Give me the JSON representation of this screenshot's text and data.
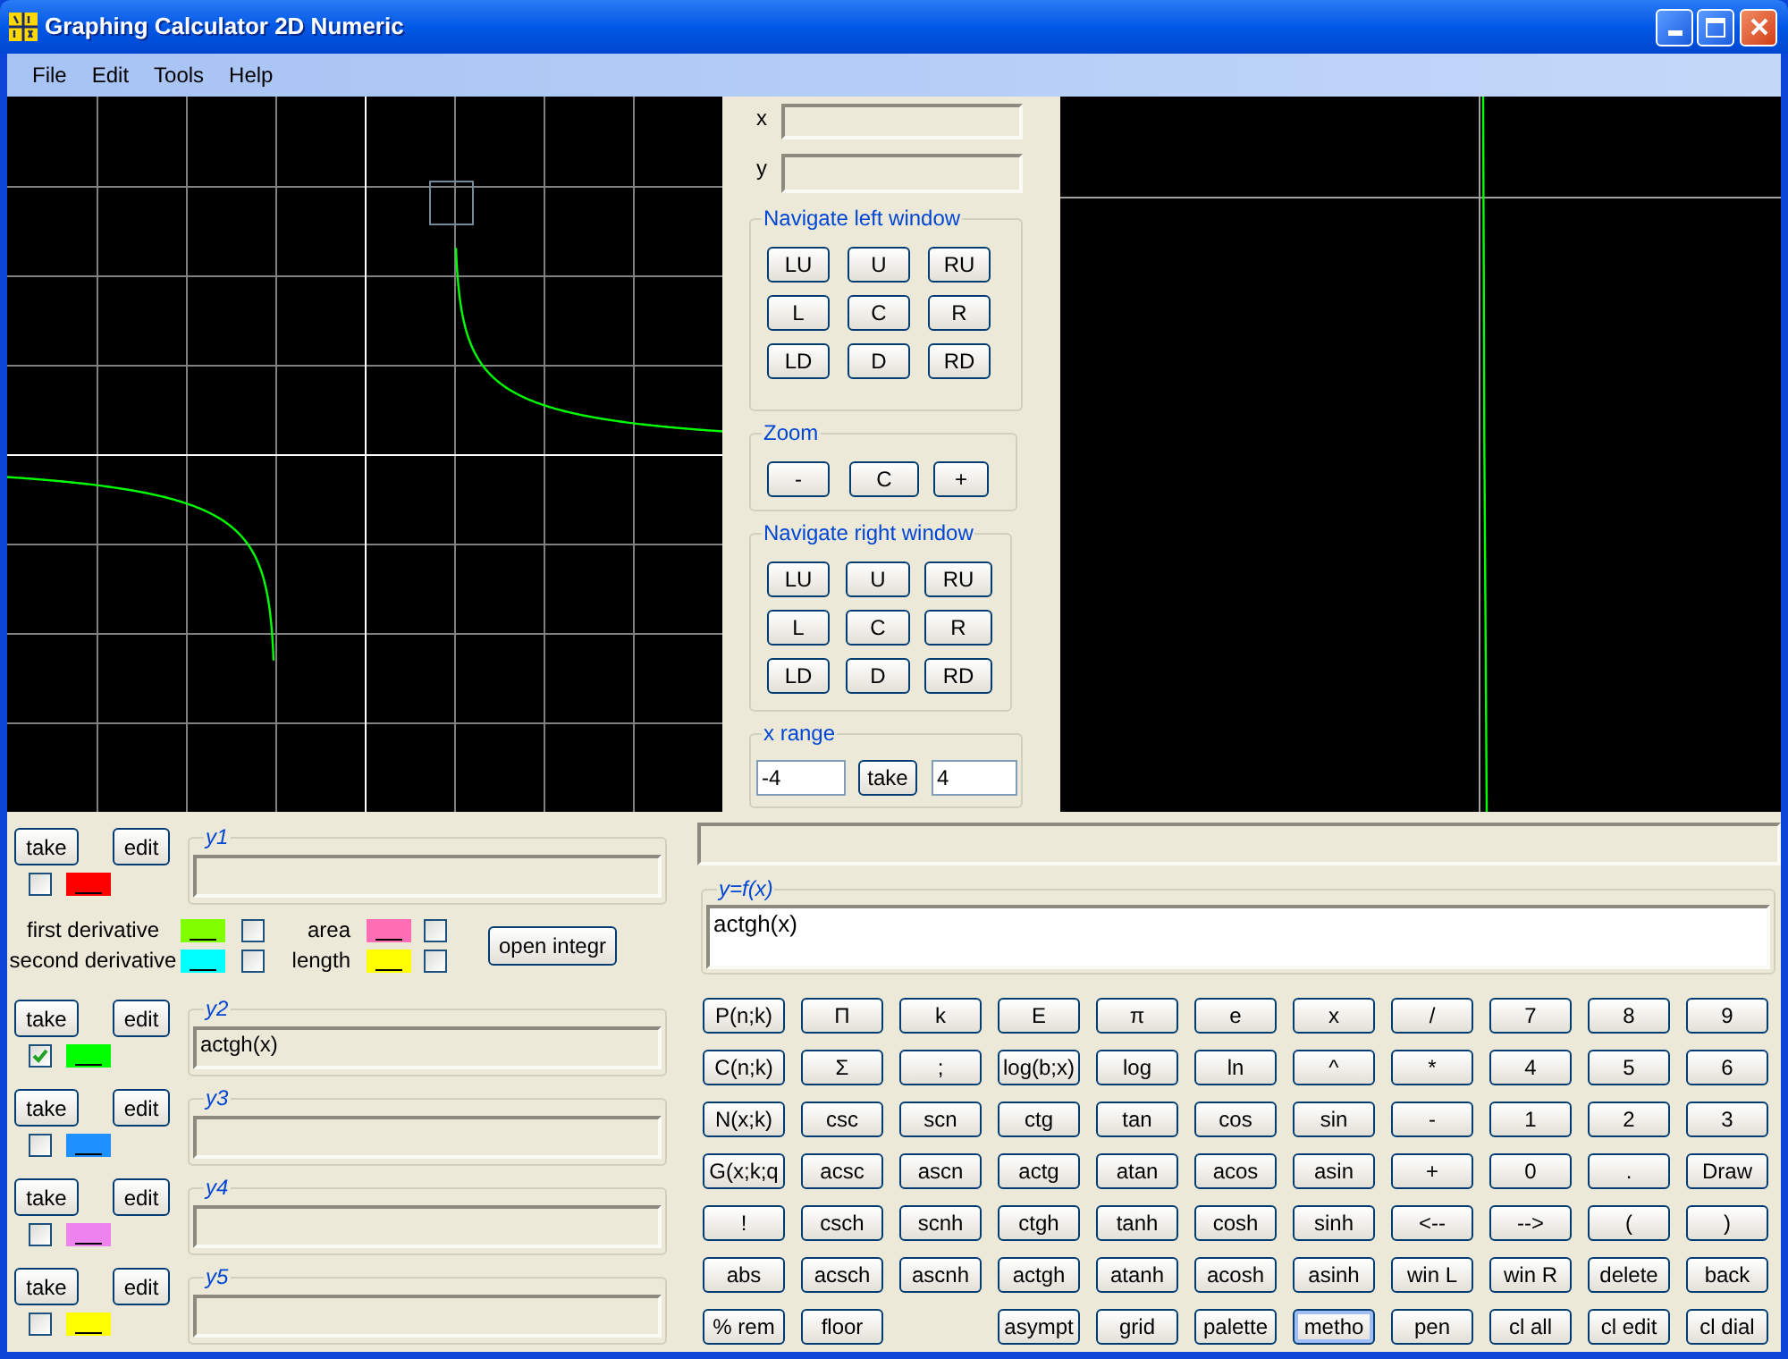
{
  "window": {
    "title": "Graphing Calculator 2D Numeric"
  },
  "menu": [
    "File",
    "Edit",
    "Tools",
    "Help"
  ],
  "coordinates": [
    {
      "label": "x"
    },
    {
      "label": "y"
    }
  ],
  "navigate_left": {
    "title": "Navigate left window",
    "buttons": [
      [
        "LU",
        "U",
        "RU"
      ],
      [
        "L",
        "C",
        "R"
      ],
      [
        "LD",
        "D",
        "RD"
      ]
    ]
  },
  "zoom": {
    "title": "Zoom",
    "buttons": [
      "-",
      "C",
      "+"
    ]
  },
  "navigate_right": {
    "title": "Navigate right window",
    "buttons": [
      [
        "LU",
        "U",
        "RU"
      ],
      [
        "L",
        "C",
        "R"
      ],
      [
        "LD",
        "D",
        "RD"
      ]
    ]
  },
  "x_range": {
    "title": "x range",
    "from": "-4",
    "button": "take",
    "to": "4"
  },
  "functions": [
    {
      "name": "y1",
      "take_button": "take",
      "edit_button": "edit",
      "checked": false,
      "color": "#ff0000"
    },
    {
      "name": "y2",
      "take_button": "take",
      "edit_button": "edit",
      "checked": true,
      "color": "#00ff00",
      "value": "actgh(x)"
    },
    {
      "name": "y3",
      "take_button": "take",
      "edit_button": "edit",
      "checked": false,
      "color": "#1e90ff"
    },
    {
      "name": "y4",
      "take_button": "take",
      "edit_button": "edit",
      "checked": false,
      "color": "#ee82ee"
    },
    {
      "name": "y5",
      "take_button": "take",
      "edit_button": "edit",
      "checked": false,
      "color": "#ffff00"
    }
  ],
  "analysis": {
    "derivatives": [
      {
        "label": "first derivative",
        "color": "#80ff00",
        "checked": false
      },
      {
        "label": "second derivative",
        "color": "#00ffff",
        "checked": false
      }
    ],
    "integrals": [
      {
        "label": "area",
        "color": "#ff6eb4",
        "checked": false
      },
      {
        "label": "length",
        "color": "#ffff00",
        "checked": false
      }
    ],
    "button": "open integr"
  },
  "expression": {
    "legend": "y=f(x)",
    "value": "actgh(x)"
  },
  "keypad": [
    [
      {
        "kind": "key",
        "label": "P(n;k)",
        "focused": false
      },
      {
        "kind": "key",
        "label": "Π",
        "focused": false
      },
      {
        "kind": "key",
        "label": "k",
        "focused": false
      },
      {
        "kind": "key",
        "label": "E",
        "focused": false
      },
      {
        "kind": "key",
        "label": "π",
        "focused": false
      },
      {
        "kind": "key",
        "label": "e",
        "focused": false
      },
      {
        "kind": "key",
        "label": "x",
        "focused": false
      },
      {
        "kind": "key",
        "label": "/",
        "focused": false
      },
      {
        "kind": "key",
        "label": "7",
        "focused": false
      },
      {
        "kind": "key",
        "label": "8",
        "focused": false
      },
      {
        "kind": "key",
        "label": "9",
        "focused": false
      }
    ],
    [
      {
        "kind": "key",
        "label": "C(n;k)",
        "focused": false
      },
      {
        "kind": "key",
        "label": "Σ",
        "focused": false
      },
      {
        "kind": "key",
        "label": ";",
        "focused": false
      },
      {
        "kind": "key",
        "label": "log(b;x)",
        "focused": false
      },
      {
        "kind": "key",
        "label": "log",
        "focused": false
      },
      {
        "kind": "key",
        "label": "ln",
        "focused": false
      },
      {
        "kind": "key",
        "label": "^",
        "focused": false
      },
      {
        "kind": "key",
        "label": "*",
        "focused": false
      },
      {
        "kind": "key",
        "label": "4",
        "focused": false
      },
      {
        "kind": "key",
        "label": "5",
        "focused": false
      },
      {
        "kind": "key",
        "label": "6",
        "focused": false
      }
    ],
    [
      {
        "kind": "key",
        "label": "N(x;k)",
        "focused": false
      },
      {
        "kind": "key",
        "label": "csc",
        "focused": false
      },
      {
        "kind": "key",
        "label": "scn",
        "focused": false
      },
      {
        "kind": "key",
        "label": "ctg",
        "focused": false
      },
      {
        "kind": "key",
        "label": "tan",
        "focused": false
      },
      {
        "kind": "key",
        "label": "cos",
        "focused": false
      },
      {
        "kind": "key",
        "label": "sin",
        "focused": false
      },
      {
        "kind": "key",
        "label": "-",
        "focused": false
      },
      {
        "kind": "key",
        "label": "1",
        "focused": false
      },
      {
        "kind": "key",
        "label": "2",
        "focused": false
      },
      {
        "kind": "key",
        "label": "3",
        "focused": false
      }
    ],
    [
      {
        "kind": "key",
        "label": "G(x;k;q",
        "focused": false
      },
      {
        "kind": "key",
        "label": "acsc",
        "focused": false
      },
      {
        "kind": "key",
        "label": "ascn",
        "focused": false
      },
      {
        "kind": "key",
        "label": "actg",
        "focused": false
      },
      {
        "kind": "key",
        "label": "atan",
        "focused": false
      },
      {
        "kind": "key",
        "label": "acos",
        "focused": false
      },
      {
        "kind": "key",
        "label": "asin",
        "focused": false
      },
      {
        "kind": "key",
        "label": "+",
        "focused": false
      },
      {
        "kind": "key",
        "label": "0",
        "focused": false
      },
      {
        "kind": "key",
        "label": ".",
        "focused": false
      },
      {
        "kind": "key",
        "label": "Draw",
        "focused": false
      }
    ],
    [
      {
        "kind": "key",
        "label": "!",
        "focused": false
      },
      {
        "kind": "key",
        "label": "csch",
        "focused": false
      },
      {
        "kind": "key",
        "label": "scnh",
        "focused": false
      },
      {
        "kind": "key",
        "label": "ctgh",
        "focused": false
      },
      {
        "kind": "key",
        "label": "tanh",
        "focused": false
      },
      {
        "kind": "key",
        "label": "cosh",
        "focused": false
      },
      {
        "kind": "key",
        "label": "sinh",
        "focused": false
      },
      {
        "kind": "key",
        "label": "<--",
        "focused": false
      },
      {
        "kind": "key",
        "label": "-->",
        "focused": false
      },
      {
        "kind": "key",
        "label": "(",
        "focused": false
      },
      {
        "kind": "key",
        "label": ")",
        "focused": false
      }
    ],
    [
      {
        "kind": "key",
        "label": "abs",
        "focused": false
      },
      {
        "kind": "key",
        "label": "acsch",
        "focused": false
      },
      {
        "kind": "key",
        "label": "ascnh",
        "focused": false
      },
      {
        "kind": "key",
        "label": "actgh",
        "focused": false
      },
      {
        "kind": "key",
        "label": "atanh",
        "focused": false
      },
      {
        "kind": "key",
        "label": "acosh",
        "focused": false
      },
      {
        "kind": "key",
        "label": "asinh",
        "focused": false
      },
      {
        "kind": "key",
        "label": "win L",
        "focused": false
      },
      {
        "kind": "key",
        "label": "win R",
        "focused": false
      },
      {
        "kind": "key",
        "label": "delete",
        "focused": false
      },
      {
        "kind": "key",
        "label": "back",
        "focused": false
      }
    ],
    [
      {
        "kind": "key",
        "label": "% rem",
        "focused": false
      },
      {
        "kind": "key",
        "label": "floor",
        "focused": false
      },
      {
        "kind": "blank"
      },
      {
        "kind": "key",
        "label": "asympt",
        "focused": false
      },
      {
        "kind": "key",
        "label": "grid",
        "focused": false
      },
      {
        "kind": "key",
        "label": "palette",
        "focused": false
      },
      {
        "kind": "key",
        "label": "metho",
        "focused": true
      },
      {
        "kind": "key",
        "label": "pen",
        "focused": false
      },
      {
        "kind": "key",
        "label": "cl all",
        "focused": false
      },
      {
        "kind": "key",
        "label": "cl edit",
        "focused": false
      },
      {
        "kind": "key",
        "label": "cl dial",
        "focused": false
      }
    ]
  ]
}
